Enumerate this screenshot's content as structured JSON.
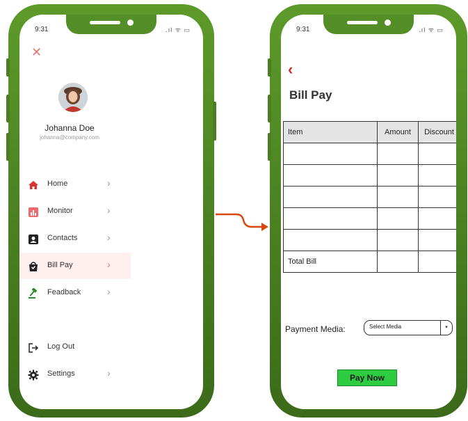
{
  "left_phone": {
    "status": {
      "time": "9:31",
      "icons": ".ıl ᯤ ▭"
    },
    "profile": {
      "name": "Johanna Doe",
      "email": "johanna@company.com"
    },
    "menu": [
      {
        "label": "Home",
        "icon": "home-icon"
      },
      {
        "label": "Monitor",
        "icon": "chart-icon"
      },
      {
        "label": "Contacts",
        "icon": "contact-card-icon"
      },
      {
        "label": "Bill Pay",
        "icon": "shopping-bag-icon",
        "active": true
      },
      {
        "label": "Feadback",
        "icon": "gavel-icon"
      }
    ],
    "footer_menu": [
      {
        "label": "Log Out",
        "icon": "logout-icon"
      },
      {
        "label": "Settings",
        "icon": "gear-icon"
      }
    ],
    "chevron": "›",
    "close_glyph": "✕"
  },
  "right_phone": {
    "status": {
      "time": "9:31",
      "icons": ".ıl ᯤ ▭"
    },
    "back_glyph": "‹",
    "title": "Bill Pay",
    "table": {
      "headers": [
        "Item",
        "Amount",
        "Discount"
      ],
      "total_label": "Total Bill"
    },
    "payment_media_label": "Payment Media:",
    "select_placeholder": "Select Media",
    "select_arrow": "▾",
    "pay_button": "Pay Now"
  },
  "colors": {
    "phone_green": "#4d8423",
    "accent_red": "#cc2a2a",
    "active_row": "#fff0f0",
    "pay_green": "#2ecc40"
  }
}
